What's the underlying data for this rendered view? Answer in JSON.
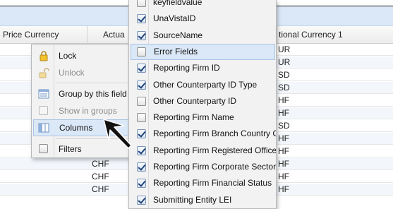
{
  "grid": {
    "columns": [
      {
        "label": "Price Currency"
      },
      {
        "label": "Actua"
      },
      {
        "label": "tional Currency 1"
      }
    ],
    "rows": [
      {
        "price_currency": "",
        "notional_currency_1": "UR"
      },
      {
        "price_currency": "",
        "notional_currency_1": "UR"
      },
      {
        "price_currency": "",
        "notional_currency_1": "SD"
      },
      {
        "price_currency": "",
        "notional_currency_1": "SD"
      },
      {
        "price_currency": "",
        "notional_currency_1": "HF"
      },
      {
        "price_currency": "",
        "notional_currency_1": "HF"
      },
      {
        "price_currency": "",
        "notional_currency_1": "SD"
      },
      {
        "price_currency": "",
        "notional_currency_1": "HF"
      },
      {
        "price_currency": "CHF",
        "notional_currency_1": "HF"
      },
      {
        "price_currency": "CHF",
        "notional_currency_1": "HF"
      },
      {
        "price_currency": "CHF",
        "notional_currency_1": "HF"
      },
      {
        "price_currency": "CHF",
        "notional_currency_1": "HF"
      }
    ]
  },
  "context_menu": {
    "items": [
      {
        "label": "Lock",
        "icon": "padlock-locked-icon",
        "disabled": false
      },
      {
        "label": "Unlock",
        "icon": "padlock-unlocked-icon",
        "disabled": true
      },
      {
        "label": "Group by this field",
        "icon": "group-by-icon",
        "disabled": false
      },
      {
        "label": "Show in groups",
        "icon": "checkbox-icon",
        "disabled": true
      },
      {
        "label": "Columns",
        "icon": "columns-icon",
        "disabled": false,
        "active": true,
        "submenu": true
      },
      {
        "label": "Filters",
        "icon": "checkbox-icon",
        "disabled": false,
        "submenu": true
      }
    ]
  },
  "columns_menu": {
    "items": [
      {
        "label": "keyfieldvalue",
        "checked": false
      },
      {
        "label": "UnaVistaID",
        "checked": true
      },
      {
        "label": "SourceName",
        "checked": true
      },
      {
        "label": "Error Fields",
        "checked": false,
        "hover": true
      },
      {
        "label": "Reporting Firm ID",
        "checked": true
      },
      {
        "label": "Other Counterparty ID Type",
        "checked": true
      },
      {
        "label": "Other Counterparty ID",
        "checked": false
      },
      {
        "label": "Reporting Firm Name",
        "checked": false
      },
      {
        "label": "Reporting Firm Branch Country Code",
        "checked": true
      },
      {
        "label": "Reporting Firm Registered Office",
        "checked": true
      },
      {
        "label": "Reporting Firm Corporate Sector",
        "checked": true
      },
      {
        "label": "Reporting Firm Financial Status",
        "checked": true
      },
      {
        "label": "Submitting Entity LEI",
        "checked": true
      }
    ]
  },
  "colors": {
    "header_band": "#dbe8f7",
    "menu_bg": "#f2f2f2",
    "highlight": "#dbe8f7",
    "highlight_border": "#a9c3e3",
    "submenu_arrow": "#4a7ebb"
  }
}
